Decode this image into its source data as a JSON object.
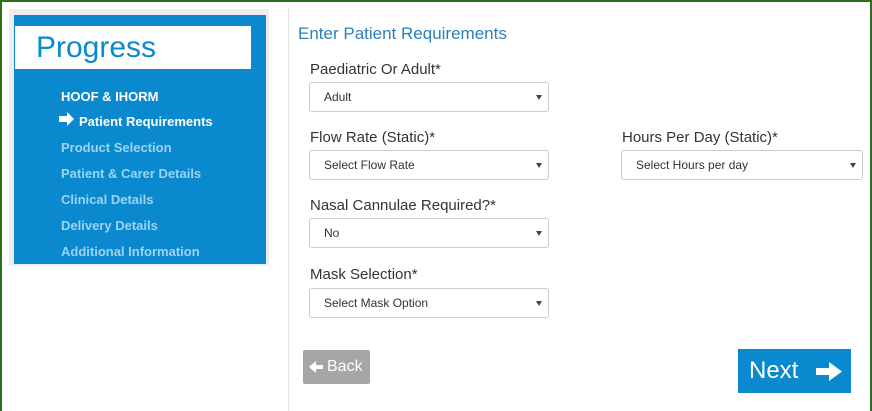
{
  "sidebar": {
    "title": "Progress",
    "steps": [
      {
        "label": "HOOF & IHORM",
        "state": "done"
      },
      {
        "label": "Patient Requirements",
        "state": "current",
        "icon": "arrow-right-icon"
      },
      {
        "label": "Product Selection",
        "state": "pending"
      },
      {
        "label": "Patient & Carer Details",
        "state": "pending"
      },
      {
        "label": "Clinical Details",
        "state": "pending"
      },
      {
        "label": "Delivery Details",
        "state": "pending"
      },
      {
        "label": "Additional Information",
        "state": "pending"
      }
    ]
  },
  "form": {
    "heading": "Enter Patient Requirements",
    "paediatric": {
      "label": "Paediatric Or Adult*",
      "value": "Adult"
    },
    "flow_rate": {
      "label": "Flow Rate (Static)*",
      "value": "Select Flow Rate"
    },
    "hours": {
      "label": "Hours Per Day (Static)*",
      "value": "Select Hours per day"
    },
    "nasal": {
      "label": "Nasal Cannulae Required?*",
      "value": "No"
    },
    "mask": {
      "label": "Mask Selection*",
      "value": "Select Mask Option"
    }
  },
  "buttons": {
    "back": "Back",
    "next": "Next"
  },
  "colors": {
    "accent": "#0a89cf",
    "frame": "#2e6f1f",
    "pending_step": "#9dd3f2"
  }
}
